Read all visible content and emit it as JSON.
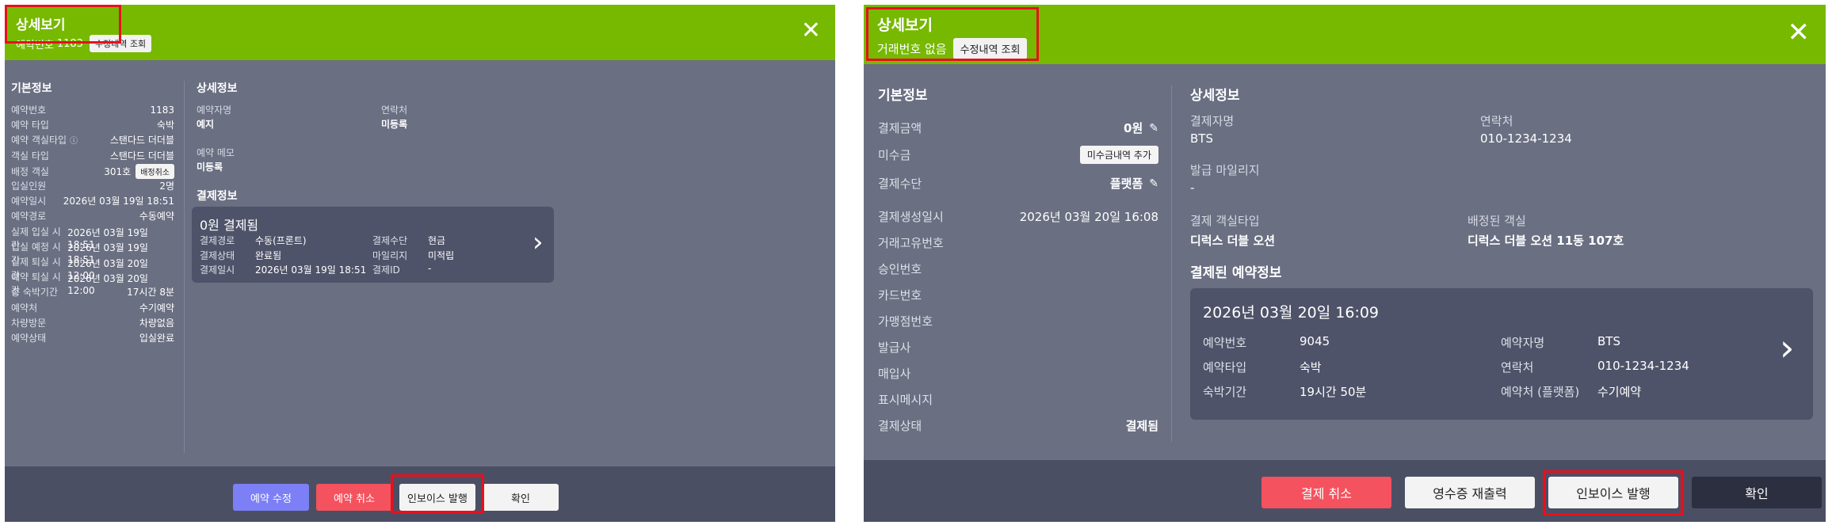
{
  "left": {
    "title": "상세보기",
    "sub_label": "예약번호",
    "sub_value": "1183",
    "history_btn": "수정내역 조회",
    "close_icon": "✕",
    "basic_title": "기본정보",
    "rows": [
      {
        "label": "예약번호",
        "value": "1183"
      },
      {
        "label": "예약 타입",
        "value": "숙박"
      },
      {
        "label": "예약 객실타입",
        "value": "스탠다드 더더블"
      },
      {
        "label": "객실 타입",
        "value": "스탠다드 더더블"
      },
      {
        "label": "배정 객실",
        "value": "301호"
      },
      {
        "label": "입실인원",
        "value": "2명"
      },
      {
        "label": "예약일시",
        "value": "2026년 03월 19일 18:51"
      },
      {
        "label": "예약경로",
        "value": "수동예약"
      },
      {
        "label": "실제 입실 시간",
        "value": "2026년 03월 19일 18:51"
      },
      {
        "label": "입실 예정 시간",
        "value": "2026년 03월 19일 18:51"
      },
      {
        "label": "실제 퇴실 시간",
        "value": "2026년 03월 20일 12:00"
      },
      {
        "label": "예약 퇴실 시간",
        "value": "2026년 03월 20일 12:00"
      },
      {
        "label": "총 숙박기간",
        "value": "17시간 8분"
      },
      {
        "label": "예약처",
        "value": "수기예약"
      },
      {
        "label": "차량방문",
        "value": "차량없음"
      },
      {
        "label": "예약상태",
        "value": "입실완료"
      }
    ],
    "info_icon": "ⓘ",
    "assign_cancel_btn": "배정취소",
    "detail_title": "상세정보",
    "name_label": "예약자명",
    "name_value": "예지",
    "contact_label": "연락처",
    "contact_value": "미등록",
    "memo_label": "예약 메모",
    "memo_value": "미등록",
    "payment_title": "결제정보",
    "card_title": "0원 결제됨",
    "card_rows": [
      {
        "label": "결제경로",
        "value": "수동(프론트)",
        "label2": "결제수단",
        "value2": "현금"
      },
      {
        "label": "결제상태",
        "value": "완료됨",
        "label2": "마일리지",
        "value2": "미적립"
      },
      {
        "label": "결제일시",
        "value": "2026년 03월 19일 18:51",
        "label2": "결제ID",
        "value2": "-"
      }
    ],
    "chevron_icon": "›",
    "buttons": {
      "edit": "예약 수정",
      "cancel": "예약 취소",
      "invoice": "인보이스 발행",
      "confirm": "확인"
    },
    "colors": {
      "header": "#76b900",
      "body": "#6a6f82",
      "card": "#4f5369",
      "highlight": "#e8101d"
    }
  },
  "right": {
    "title": "상세보기",
    "sub_text": "거래번호 없음",
    "history_btn": "수정내역 조회",
    "close_icon": "✕",
    "basic_title": "기본정보",
    "rows": [
      {
        "label": "결제금액",
        "value": "0원"
      },
      {
        "label": "미수금",
        "value": ""
      },
      {
        "label": "결제수단",
        "value": "플랫폼"
      },
      {
        "label": "결제생성일시",
        "value": "2026년 03월 20일 16:08"
      },
      {
        "label": "거래고유번호",
        "value": ""
      },
      {
        "label": "승인번호",
        "value": ""
      },
      {
        "label": "카드번호",
        "value": ""
      },
      {
        "label": "가맹점번호",
        "value": ""
      },
      {
        "label": "발급사",
        "value": ""
      },
      {
        "label": "매입사",
        "value": ""
      },
      {
        "label": "표시메시지",
        "value": ""
      },
      {
        "label": "결제상태",
        "value": "결제됨"
      }
    ],
    "pencil_icon": "✎",
    "unpaid_add_btn": "미수금내역 추가",
    "detail_title": "상세정보",
    "payer_label": "결제자명",
    "payer_value": "BTS",
    "contact_label": "연락처",
    "contact_value": "010-1234-1234",
    "mileage_label": "발급 마일리지",
    "mileage_value": "-",
    "roomtype_label": "결제 객실타입",
    "roomtype_value": "디럭스 더블 오션",
    "assigned_label": "배정된 객실",
    "assigned_value": "디럭스 더블 오션 11동 107호",
    "reservation_title": "결제된 예약정보",
    "card_title": "2026년 03월 20일 16:09",
    "card_rows": [
      {
        "label": "예약번호",
        "value": "9045",
        "label2": "예약자명",
        "value2": "BTS"
      },
      {
        "label": "예약타입",
        "value": "숙박",
        "label2": "연락처",
        "value2": "010-1234-1234"
      },
      {
        "label": "숙박기간",
        "value": "19시간 50분",
        "label2": "예약처 (플랫폼)",
        "value2": "수기예약"
      }
    ],
    "chevron_icon": "›",
    "buttons": {
      "cancel": "결제 취소",
      "reprint": "영수증 재출력",
      "invoice": "인보이스 발행",
      "confirm": "확인"
    }
  }
}
